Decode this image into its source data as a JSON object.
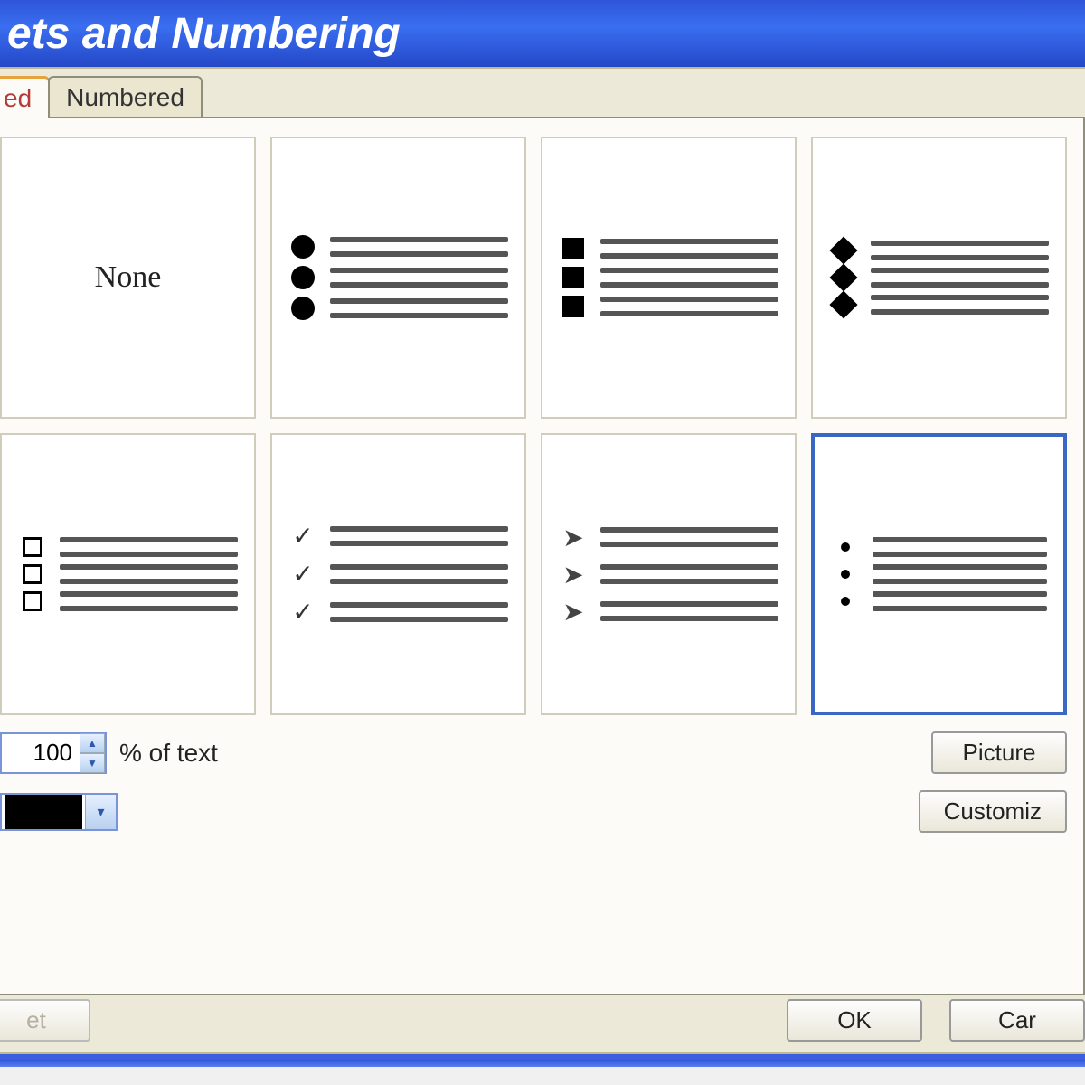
{
  "window": {
    "title": "ets and Numbering"
  },
  "tabs": {
    "bulleted": "ed",
    "numbered": "Numbered"
  },
  "options": {
    "none_label": "None",
    "styles": [
      {
        "name": "none",
        "type": "none",
        "selected": false
      },
      {
        "name": "disc",
        "type": "circle",
        "selected": false
      },
      {
        "name": "square-filled",
        "type": "square-f",
        "selected": false
      },
      {
        "name": "diamond",
        "type": "diamond",
        "selected": false
      },
      {
        "name": "square-outline",
        "type": "square-o",
        "selected": false
      },
      {
        "name": "check",
        "type": "check",
        "selected": false
      },
      {
        "name": "arrow",
        "type": "arrow",
        "selected": false
      },
      {
        "name": "small-dot",
        "type": "dot",
        "selected": true
      }
    ]
  },
  "size": {
    "value": "100",
    "suffix_label": "% of text"
  },
  "color": {
    "value": "#000000"
  },
  "buttons": {
    "picture": "Picture",
    "customize": "Customiz",
    "reset": "et",
    "ok": "OK",
    "cancel": "Car"
  }
}
